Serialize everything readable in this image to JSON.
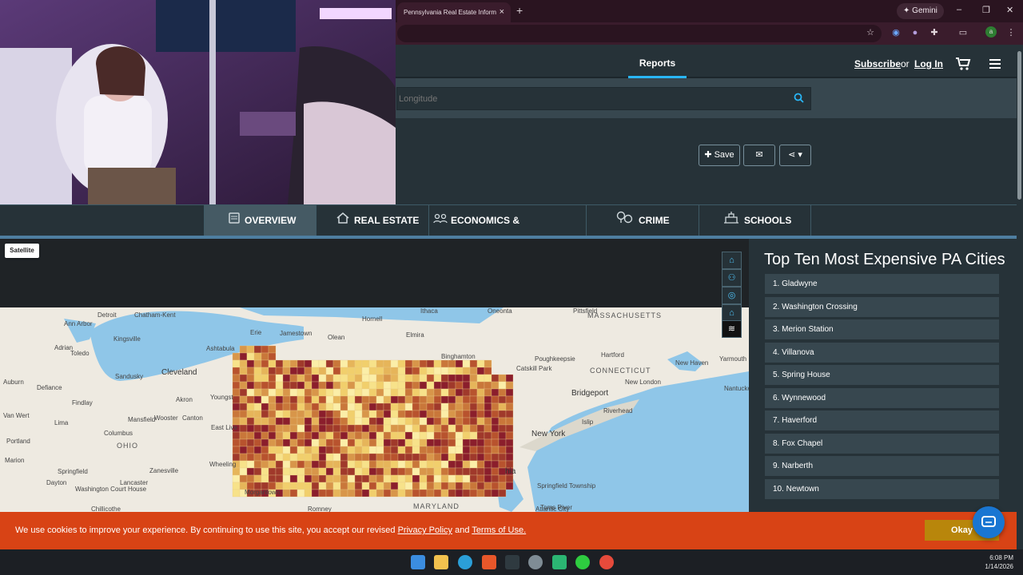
{
  "browser": {
    "tab_title": "Pennsylvania Real Estate Inform",
    "tab_close": "×",
    "new_tab": "+",
    "gemini_label": "Gemini",
    "window_controls": [
      "–",
      "❐",
      "✕"
    ]
  },
  "header": {
    "nav_reports": "Reports",
    "subscribe": "Subscribe",
    "or": "or",
    "login": "Log In"
  },
  "search": {
    "placeholder": "Longitude"
  },
  "actions": {
    "save": "Save"
  },
  "report_tabs": [
    {
      "label": "OVERVIEW",
      "icon": "report-icon",
      "active": true
    },
    {
      "label": "REAL ESTATE",
      "icon": "house-icon"
    },
    {
      "label": "ECONOMICS & DEMOGRAPHICS",
      "icon": "people-icon"
    },
    {
      "label": "CRIME",
      "icon": "crime-icon"
    },
    {
      "label": "SCHOOLS",
      "icon": "school-icon"
    }
  ],
  "map": {
    "satellite_label": "Satellite",
    "tools": [
      "house-icon",
      "people-icon",
      "crime-icon",
      "school-icon",
      "layers-icon"
    ],
    "labels": [
      "Detroit",
      "Chatham-Kent",
      "Ann Arbor",
      "Kingsville",
      "Adrian",
      "Toledo",
      "Sandusky",
      "Cleveland",
      "Auburn",
      "Defiance",
      "Findlay",
      "Van Wert",
      "Lima",
      "Akron",
      "Canton",
      "Youngst",
      "Ashtabula",
      "Erie",
      "Jamestown",
      "Olean",
      "Hornell",
      "Ithaca",
      "Elmira",
      "Binghamton",
      "Oneonta",
      "Pittsfield",
      "MASSACHUSETTS",
      "Hartford",
      "Catskill Park",
      "Poughkeepsie",
      "CONNECTICUT",
      "New Haven",
      "Yarmouth",
      "New London",
      "Bridgeport",
      "Nantucket",
      "Riverhead",
      "Islip",
      "New York",
      "Mansfield",
      "Wooster",
      "OHIO",
      "Portland",
      "Marion",
      "Columbus",
      "Springfield",
      "Dayton",
      "Zanesville",
      "Lancaster",
      "Washington Court House",
      "Chillicothe",
      "East Live",
      "Wheeling",
      "Morgantown",
      "Romney",
      "MARYLAND",
      "Toms River",
      "Atlantic City",
      "Springfield Township",
      "hia"
    ],
    "fill_colors": [
      "#8b1e2c",
      "#a0392b",
      "#b8532e",
      "#c9773a",
      "#d8964a",
      "#e6b55a",
      "#f1cf6c",
      "#f7e28a",
      "#fbeea8"
    ]
  },
  "panel": {
    "title": "Top Ten Most Expensive PA Cities",
    "cities": [
      "1. Gladwyne",
      "2. Washington Crossing",
      "3. Merion Station",
      "4. Villanova",
      "5. Spring House",
      "6. Wynnewood",
      "7. Haverford",
      "8. Fox Chapel",
      "9. Narberth",
      "10. Newtown"
    ]
  },
  "cookie": {
    "text": "We use cookies to improve your experience. By continuing to use this site, you accept our revised",
    "privacy": "Privacy Policy",
    "and": "and",
    "terms": "Terms of Use.",
    "okay": "Okay"
  },
  "taskbar": {
    "time": "6:08 PM",
    "date": "1/14/2026"
  },
  "colors": {
    "accent": "#29b6f6",
    "header": "#263238",
    "cookie": "#d84315",
    "okay": "#b8860b"
  }
}
